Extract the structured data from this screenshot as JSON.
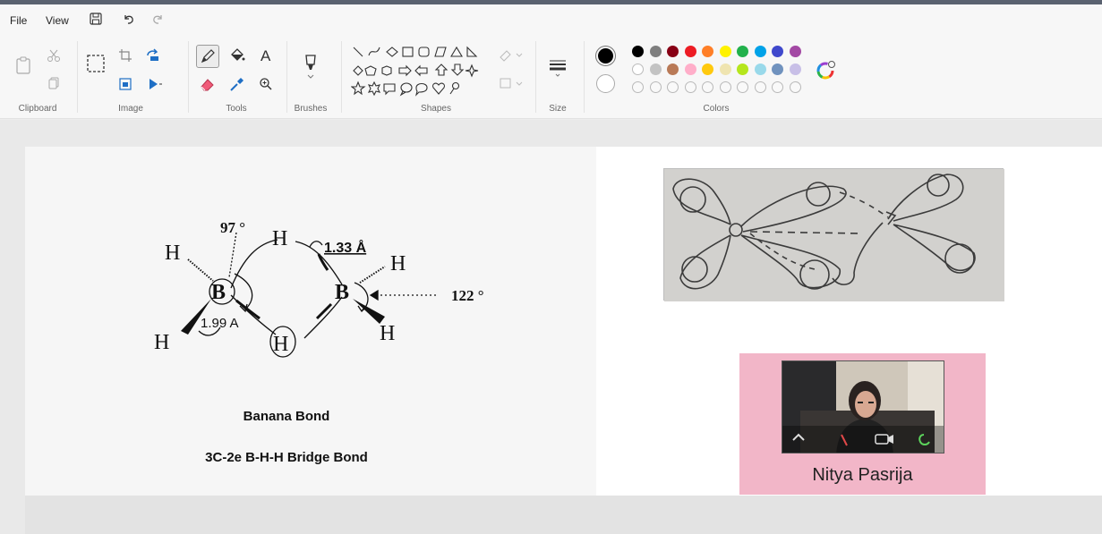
{
  "menu": {
    "file": "File",
    "view": "View"
  },
  "quick_access": [
    "save-icon",
    "undo-icon",
    "redo-icon"
  ],
  "ribbon": {
    "groups": {
      "clipboard": "Clipboard",
      "image": "Image",
      "tools": "Tools",
      "brushes": "Brushes",
      "shapes": "Shapes",
      "size": "Size",
      "colors": "Colors"
    },
    "colors": {
      "primary": "#000000",
      "secondary": "#ffffff",
      "row1": [
        "#000000",
        "#7f7f7f",
        "#880015",
        "#ed1c24",
        "#ff7f27",
        "#fff200",
        "#22b14c",
        "#00a2e8",
        "#3f48cc",
        "#a349a4"
      ],
      "row2": [
        "#ffffff",
        "#c3c3c3",
        "#b97a57",
        "#ffaec9",
        "#ffc90e",
        "#efe4b0",
        "#b5e61d",
        "#99d9ea",
        "#7092be",
        "#c8bfe7"
      ],
      "row3_empty": 10
    }
  },
  "diagram": {
    "labels": {
      "h_top_left": "H",
      "h_bottom_left": "H",
      "h_bridge_top": "H",
      "h_bridge_bottom": "H",
      "h_top_right": "H",
      "h_bottom_right": "H",
      "b_left": "B",
      "b_right": "B",
      "angle_97": "97 °",
      "bond_133": "1.33 Å",
      "bond_199": "1.99 A",
      "angle_122": "122 °"
    }
  },
  "captions": {
    "line1": "Banana Bond",
    "line2": "3C-2e B-H-H Bridge Bond"
  },
  "video": {
    "participant_name": "Nitya Pasrija"
  }
}
